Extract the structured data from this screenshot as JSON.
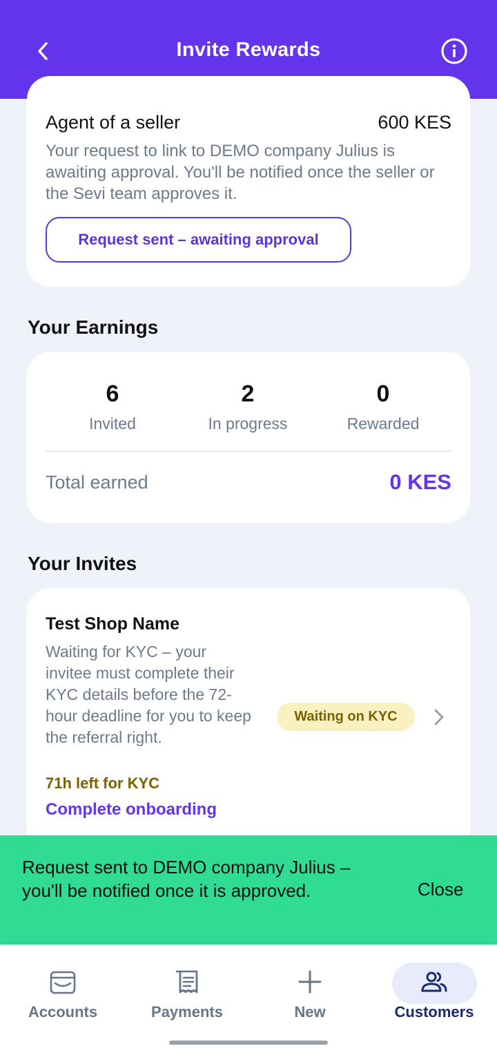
{
  "header": {
    "title": "Invite Rewards",
    "back_icon": "chevron-left-icon",
    "info_icon": "info-icon"
  },
  "seller_card": {
    "title": "Agent of a seller",
    "amount": "600 KES",
    "description": "Your request to link to DEMO company Julius is awaiting approval. You'll be notified once the seller or the Sevi team approves it.",
    "button_label": "Request sent – awaiting approval"
  },
  "earnings": {
    "section_title": "Your Earnings",
    "stats": [
      {
        "value": "6",
        "label": "Invited"
      },
      {
        "value": "2",
        "label": "In progress"
      },
      {
        "value": "0",
        "label": "Rewarded"
      }
    ],
    "total_label": "Total earned",
    "total_value": "0 KES"
  },
  "invites": {
    "section_title": "Your Invites",
    "items": [
      {
        "name": "Test Shop Name",
        "description": "Waiting for KYC – your invitee must complete their KYC details before the 72-hour deadline for you to keep the referral right.",
        "deadline": "71h left for KYC",
        "action": "Complete onboarding",
        "status": "Waiting on KYC"
      }
    ]
  },
  "snackbar": {
    "message": "Request sent to DEMO company Julius – you'll be notified once it is approved.",
    "close_label": "Close"
  },
  "bottom_nav": {
    "items": [
      {
        "label": "Accounts",
        "icon": "wallet-icon"
      },
      {
        "label": "Payments",
        "icon": "receipt-icon"
      },
      {
        "label": "New",
        "icon": "plus-icon"
      },
      {
        "label": "Customers",
        "icon": "users-icon",
        "active": true
      }
    ]
  },
  "colors": {
    "brand": "#6433ec",
    "snackbar": "#30dc94",
    "warning_bg": "#fbf0c0",
    "warning_text": "#7a6200"
  }
}
